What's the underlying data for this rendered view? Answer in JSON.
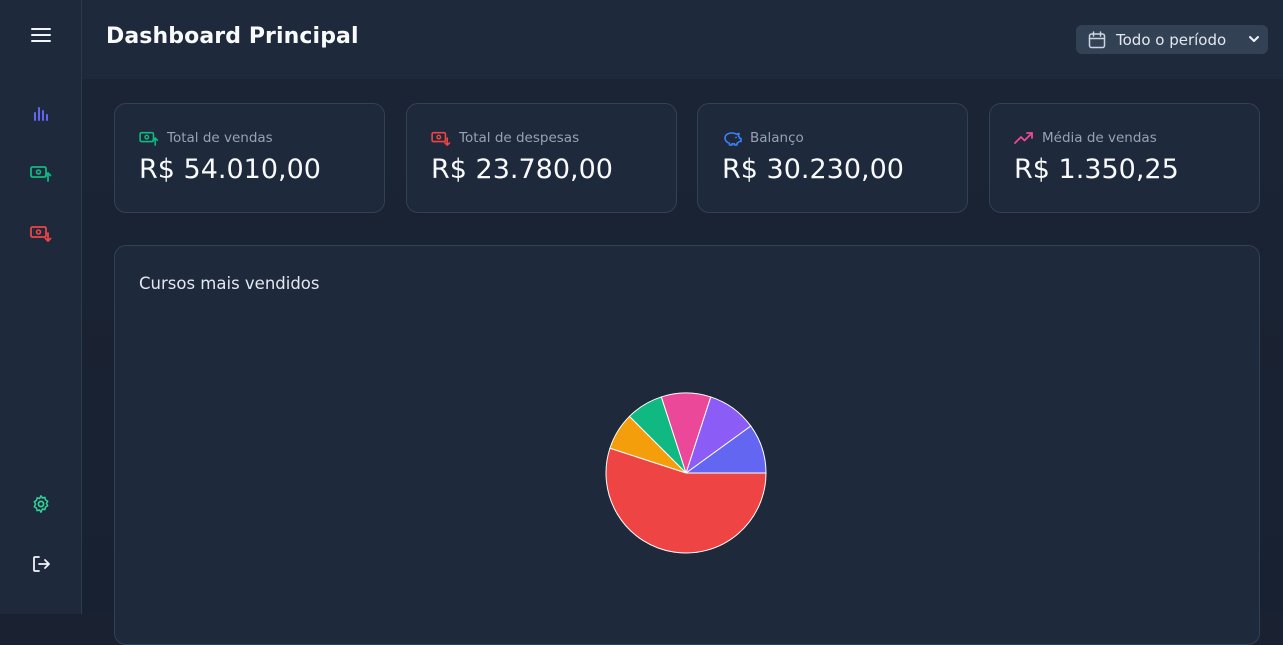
{
  "header": {
    "title": "Dashboard Principal",
    "period_select": {
      "value": "Todo o período"
    }
  },
  "sidebar": {
    "items": [
      {
        "name": "menu",
        "icon": "menu-icon"
      },
      {
        "name": "dashboard",
        "icon": "bar-chart-icon",
        "color": "#6366f1"
      },
      {
        "name": "sales",
        "icon": "money-in-icon",
        "color": "#10b981"
      },
      {
        "name": "expenses",
        "icon": "money-out-icon",
        "color": "#ef4444"
      },
      {
        "name": "settings",
        "icon": "gear-icon",
        "color": "#34d399"
      },
      {
        "name": "logout",
        "icon": "logout-icon",
        "color": "#f1f5f9"
      }
    ]
  },
  "cards": [
    {
      "label": "Total de vendas",
      "value": "R$ 54.010,00",
      "icon": "money-in-icon",
      "color": "#10b981"
    },
    {
      "label": "Total de despesas",
      "value": "R$ 23.780,00",
      "icon": "money-out-icon",
      "color": "#ef4444"
    },
    {
      "label": "Balanço",
      "value": "R$ 30.230,00",
      "icon": "piggy-bank-icon",
      "color": "#3b82f6"
    },
    {
      "label": "Média de vendas",
      "value": "R$ 1.350,25",
      "icon": "trending-up-icon",
      "color": "#ec4899"
    }
  ],
  "chart_section": {
    "title": "Cursos mais vendidos"
  },
  "chart_data": {
    "type": "pie",
    "title": "",
    "slices": [
      {
        "value": 10,
        "color": "#6366f1"
      },
      {
        "value": 10,
        "color": "#8b5cf6"
      },
      {
        "value": 10,
        "color": "#ec4899"
      },
      {
        "value": 7.5,
        "color": "#10b981"
      },
      {
        "value": 7.5,
        "color": "#f59e0b"
      },
      {
        "value": 55,
        "color": "#ef4444"
      }
    ],
    "legend": "none"
  }
}
